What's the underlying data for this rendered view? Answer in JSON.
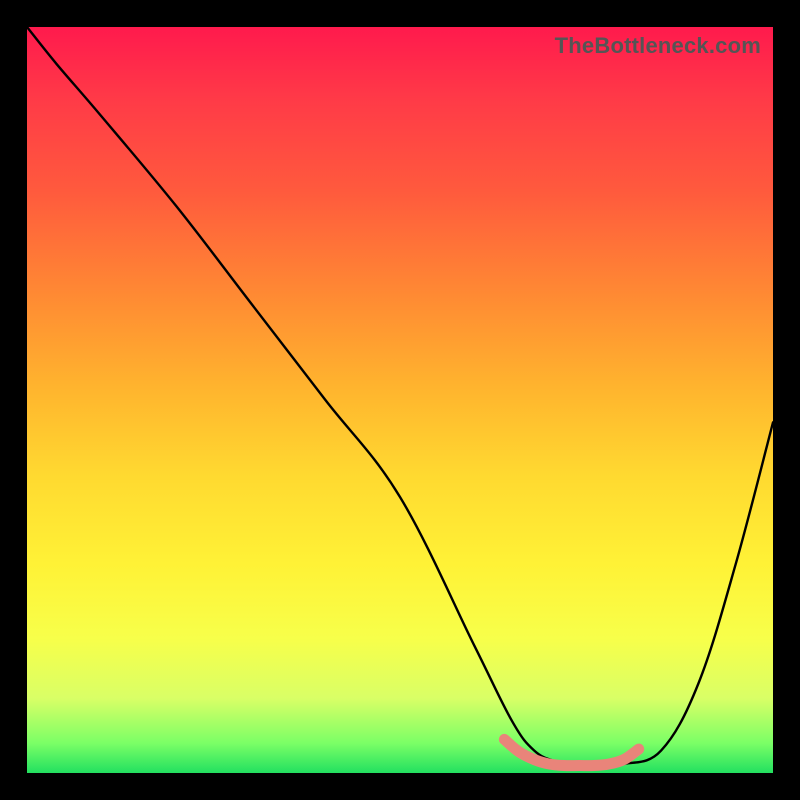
{
  "watermark": "TheBottleneck.com",
  "chart_data": {
    "type": "line",
    "title": "",
    "xlabel": "",
    "ylabel": "",
    "xlim": [
      0,
      100
    ],
    "ylim": [
      0,
      100
    ],
    "series": [
      {
        "name": "bottleneck-curve",
        "color": "#000000",
        "x": [
          0,
          4,
          10,
          20,
          30,
          40,
          50,
          60,
          65,
          68,
          71,
          74,
          77,
          80,
          85,
          90,
          95,
          100
        ],
        "y": [
          100,
          95,
          88,
          76,
          63,
          50,
          37,
          17,
          7,
          3,
          1.5,
          1,
          1,
          1.2,
          3,
          12,
          28,
          47
        ]
      },
      {
        "name": "optimal-range-highlight",
        "color": "#e9847a",
        "x": [
          64,
          66,
          68,
          70,
          72,
          74,
          76,
          78,
          80,
          82
        ],
        "y": [
          4.5,
          2.8,
          1.8,
          1.2,
          1,
          1,
          1,
          1.2,
          1.8,
          3.2
        ]
      }
    ],
    "annotations": []
  }
}
